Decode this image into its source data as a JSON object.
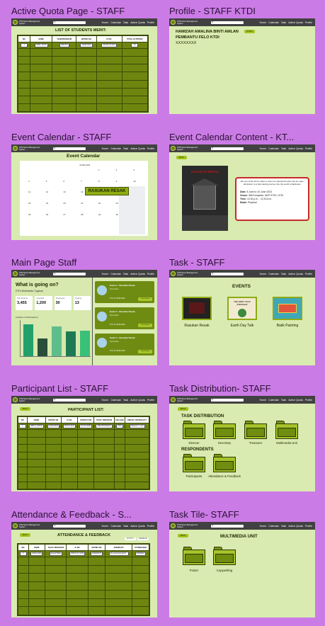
{
  "header": {
    "brand": "KTDI Event Management System",
    "search_placeholder": "Q",
    "nav": [
      "Home",
      "Calendar",
      "Task",
      "Active Quota",
      "Profile"
    ]
  },
  "cards": {
    "quota": {
      "title": "Active Quota Page - STAFF",
      "heading": "LIST OF STUDENTS MERIT:",
      "columns": [
        "NO.",
        "NAME",
        "YEAR/PROGRAM",
        "MATRIC NO",
        "IC NO.",
        "TOTAL ACTIVITIES"
      ],
      "row": [
        "1",
        "NABIL TAHIR",
        "2SECRH",
        "A22EC0019",
        "020111-01-0101",
        "10"
      ]
    },
    "profile": {
      "title": "Profile - STAFF KTDI",
      "name": "HAMIZAH AMALINA BINTI AMLAN",
      "role": "PEMBANTU FELO KTDI",
      "id": "XXXXXXXX",
      "badge": "STAFF"
    },
    "calendar": {
      "title": "Event Calendar - STAFF",
      "heading": "Event Calendar",
      "month": "JUNE 2023",
      "event": "RASUKAN RESAK",
      "days": [
        "Sun",
        "Mon",
        "Tue",
        "Wed",
        "Thu",
        "Fri",
        "Sat"
      ],
      "dates": [
        "",
        "",
        "",
        "",
        "1",
        "2",
        "3",
        "4",
        "5",
        "6",
        "7",
        "8",
        "9",
        "10",
        "11",
        "12",
        "13",
        "14",
        "15",
        "16",
        "17",
        "18",
        "19",
        "20",
        "21",
        "22",
        "23",
        "24",
        "25",
        "26",
        "27",
        "28",
        "29",
        "30",
        ""
      ]
    },
    "calcontent": {
      "title": "Event Calendar Content - KT...",
      "back": "BACK",
      "poster": "RASUKAN RESAK",
      "blurb": "Be one of the first to dare to enter our haunted house! Get an open admission to a hair-raising journey into the world of darkness.",
      "date_label": "Date:",
      "date_value": "8 June to 10 June 2023",
      "venue_label": "Venue:",
      "venue_value": "Wifi Komputer, MCR KTDI, UTM",
      "time_label": "Time:",
      "time_value": "12.30 p.m. - 12.30 a.m.",
      "mode_label": "Mode:",
      "mode_value": "Physical"
    },
    "main": {
      "title": "Main Page Staff",
      "heading": "What is going on?",
      "subheading": "KTDI Multimedia Tugasan",
      "stats": [
        {
          "label": "Total Students",
          "value": "3,455"
        },
        {
          "label": "Total Staff",
          "value": "1,200"
        },
        {
          "label": "Total Events",
          "value": "30"
        },
        {
          "label": "Ongoing",
          "value": "13"
        }
      ],
      "chart_heading": "Analytics of Participations",
      "bars": [
        {
          "value": 90,
          "color": "#22a06b"
        },
        {
          "value": 50,
          "color": "#2b4e3a"
        },
        {
          "value": 85,
          "color": "#5fbd8c"
        },
        {
          "value": 70,
          "color": "#1e7a55"
        },
        {
          "value": 72,
          "color": "#39c079"
        }
      ],
      "events": [
        {
          "name": "Event 1 : Rasukan Resak",
          "meta": "Description",
          "date": "8 TO 10 JUNE 2023",
          "btn": "View Details"
        },
        {
          "name": "Event 1 : Rasukan Resak",
          "meta": "Description",
          "date": "8 TO 10 JUNE 2023",
          "btn": "View Details"
        },
        {
          "name": "Event 1 : Rasukan Resak",
          "meta": "Description",
          "date": "8 TO 10 JUNE 2023",
          "btn": "View Details"
        }
      ]
    },
    "task": {
      "title": "Task - STAFF",
      "heading": "EVENTS",
      "events": [
        "Rasukan Resak",
        "Earth Day Talk",
        "Batik Painting"
      ],
      "earth_poster": "THE EDDY TALK STRAIGHT"
    },
    "participants": {
      "title": "Participant List - STAFF",
      "back": "BACK",
      "heading": "PARTICIPANT LIST:",
      "columns": [
        "NO.",
        "NAME",
        "MATRIC NO",
        "IC NO",
        "CONTACT NO",
        "YEAR / PROGRAM",
        "COLLEGE",
        "ORIGIN / NATIONALITY"
      ],
      "row": [
        "1",
        "ABDUL RAHIM",
        "A22EC0025",
        "030131-0101",
        "011-0123456",
        "2SECRH/2SECR",
        "KTDI",
        "Malaysia / Local"
      ]
    },
    "distribution": {
      "title": "Task Distribution- STAFF",
      "back": "BACK",
      "heading": "TASK DISTRIBUTION",
      "folders": [
        "Director",
        "Secretary",
        "Treasurer",
        "Multimedia Unit"
      ],
      "heading2": "RESPONDENTS",
      "folders2": [
        "Participants",
        "Attendance & Feedback"
      ]
    },
    "attendance": {
      "title": "Attendance & Feedback - S...",
      "back": "BACK",
      "heading": "ATTENDANCE & FEEDBACK",
      "filters": [
        "ACTIVITY",
        "FEEDBACK"
      ],
      "columns": [
        "NO.",
        "NAME",
        "YEAR / PROGRAM",
        "IC NO",
        "MATRIC NO",
        "FEEDBACK",
        "ATTENDANCE"
      ],
      "row": [
        "1",
        "Zarith Nabil",
        "Aqsyal B2E1",
        "020111-07-1234",
        "A22EC0247",
        "the event was good...",
        "PRESENT"
      ]
    },
    "tile": {
      "title": "Task Tile- STAFF",
      "back": "BACK",
      "heading": "MULTIMEDIA UNIT",
      "folders": [
        "Poster",
        "Copywriting"
      ]
    }
  }
}
